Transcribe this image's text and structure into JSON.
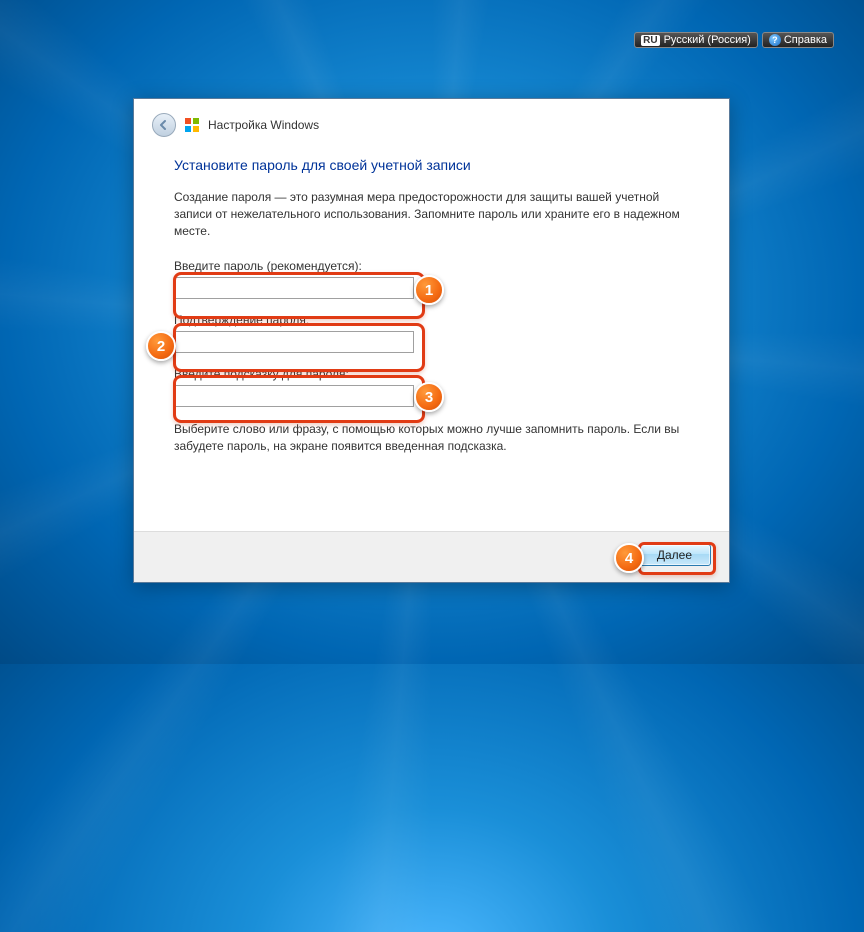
{
  "topbar": {
    "lang_code": "RU",
    "lang_label": "Русский (Россия)",
    "help_label": "Справка"
  },
  "dialog": {
    "title": "Настройка Windows",
    "heading": "Установите пароль для своей учетной записи",
    "description": "Создание пароля — это разумная мера предосторожности для защиты вашей учетной записи от нежелательного использования. Запомните пароль или храните его в надежном месте.",
    "fields": {
      "password_label": "Введите пароль (рекомендуется):",
      "password_value": "",
      "confirm_label": "Подтверждение пароля:",
      "confirm_value": "",
      "hint_label": "Введите подсказку для пароля:",
      "hint_value": ""
    },
    "hint_text": "Выберите слово или фразу, с помощью которых можно лучше запомнить пароль. Если вы забудете пароль, на экране появится введенная подсказка.",
    "next_button": "Далее"
  },
  "annotations": {
    "b1": "1",
    "b2": "2",
    "b3": "3",
    "b4": "4"
  }
}
